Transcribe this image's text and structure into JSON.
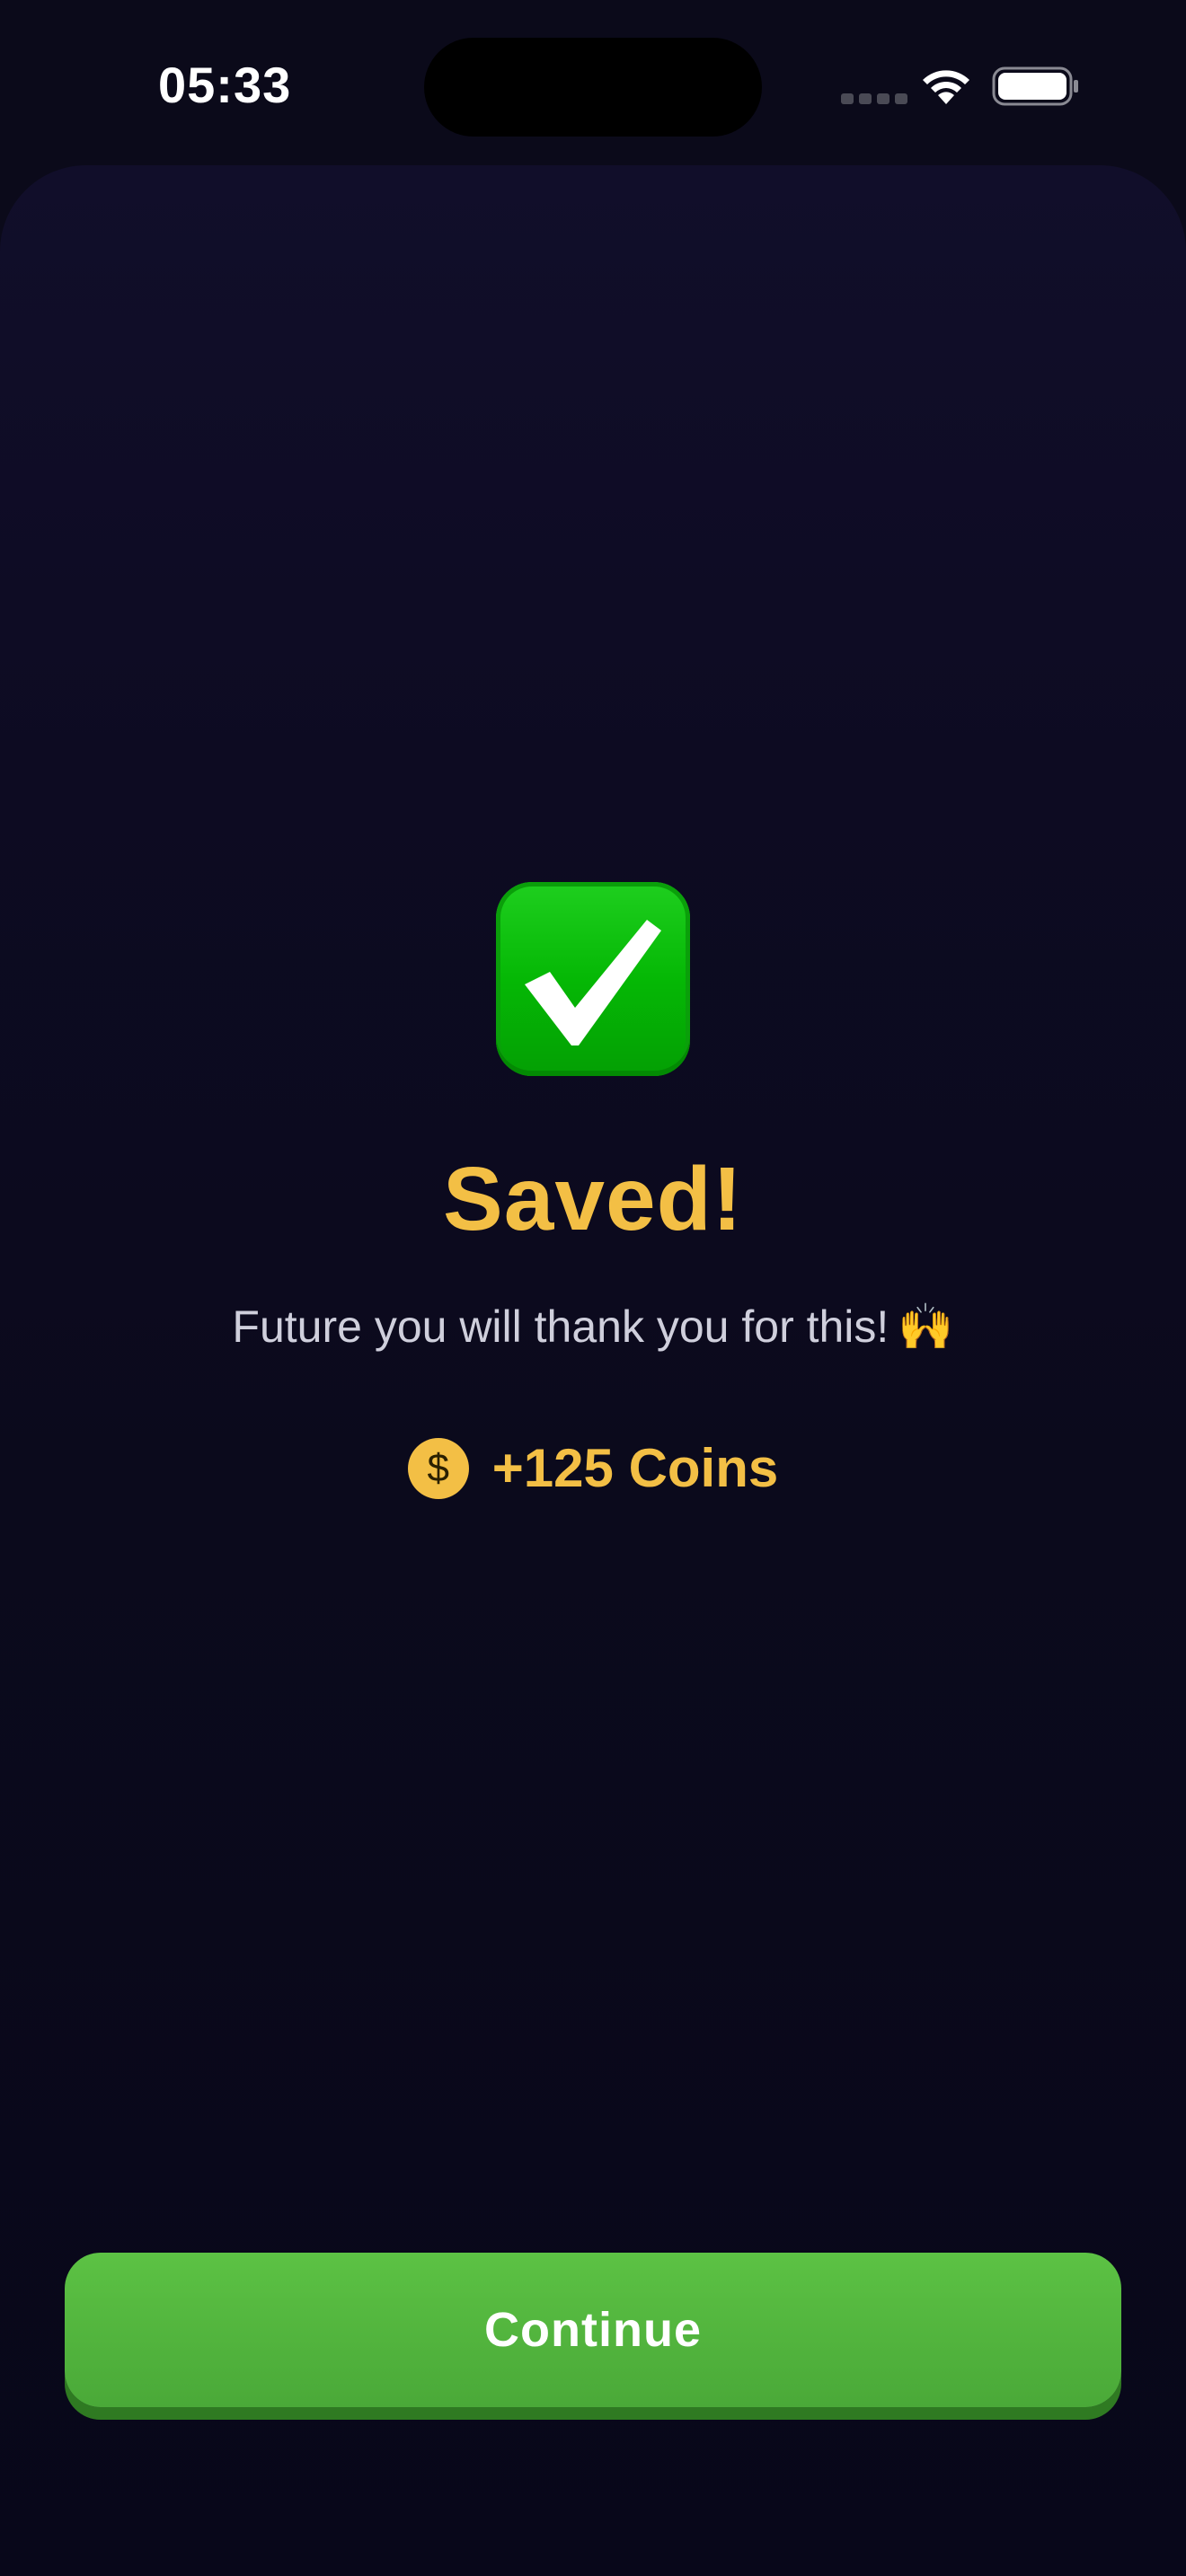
{
  "status_bar": {
    "time": "05:33"
  },
  "result": {
    "title": "Saved!",
    "message": "Future you will thank you for this!",
    "message_emoji": "🙌",
    "check_emoji": "check-mark-button-icon"
  },
  "reward": {
    "coin_symbol": "$",
    "label": "+125 Coins"
  },
  "actions": {
    "continue_label": "Continue"
  },
  "colors": {
    "accent_gold": "#f3bf45",
    "button_green": "#55b83e",
    "background": "#0b0a1a"
  }
}
